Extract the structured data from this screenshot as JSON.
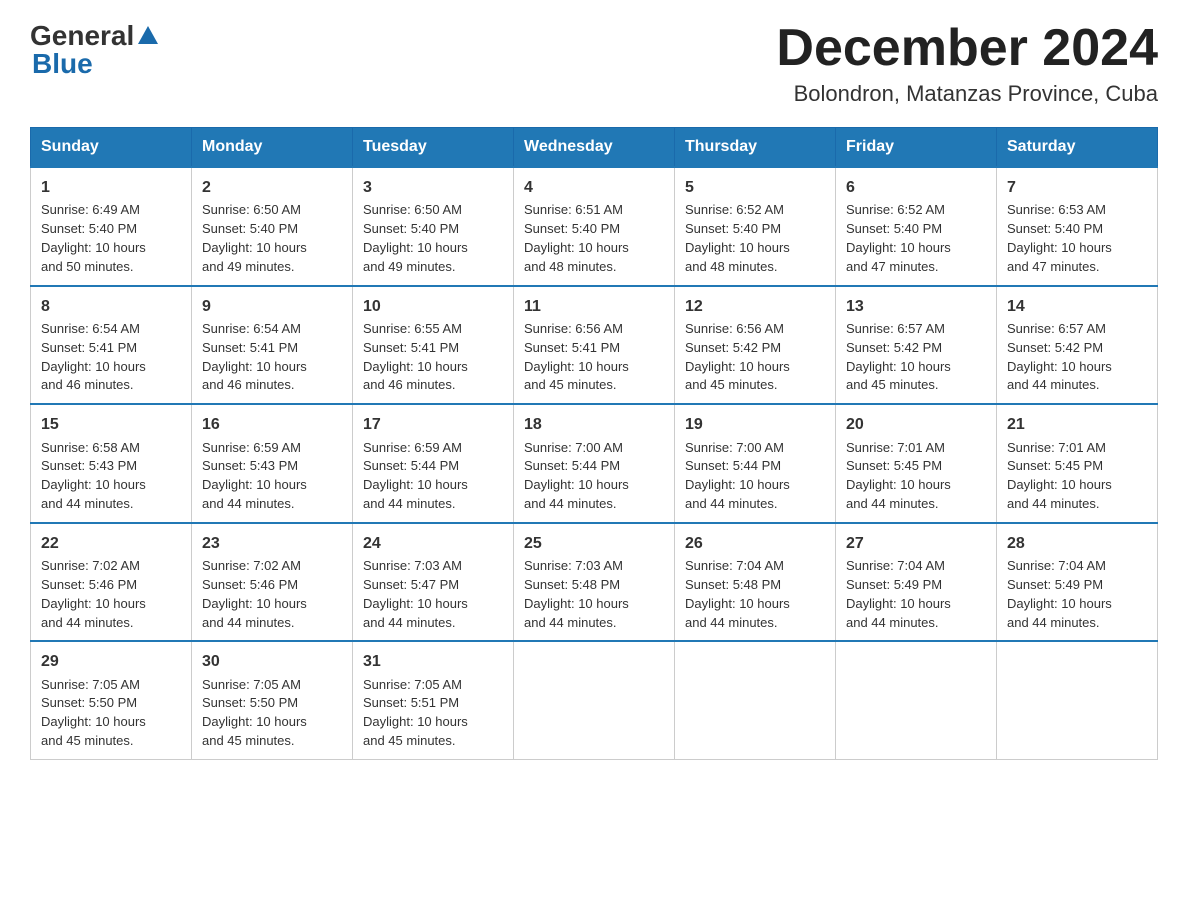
{
  "header": {
    "logo_general": "General",
    "logo_blue": "Blue",
    "month_year": "December 2024",
    "location": "Bolondron, Matanzas Province, Cuba"
  },
  "days_of_week": [
    "Sunday",
    "Monday",
    "Tuesday",
    "Wednesday",
    "Thursday",
    "Friday",
    "Saturday"
  ],
  "weeks": [
    [
      {
        "day": 1,
        "sunrise": "6:49 AM",
        "sunset": "5:40 PM",
        "daylight": "10 hours and 50 minutes."
      },
      {
        "day": 2,
        "sunrise": "6:50 AM",
        "sunset": "5:40 PM",
        "daylight": "10 hours and 49 minutes."
      },
      {
        "day": 3,
        "sunrise": "6:50 AM",
        "sunset": "5:40 PM",
        "daylight": "10 hours and 49 minutes."
      },
      {
        "day": 4,
        "sunrise": "6:51 AM",
        "sunset": "5:40 PM",
        "daylight": "10 hours and 48 minutes."
      },
      {
        "day": 5,
        "sunrise": "6:52 AM",
        "sunset": "5:40 PM",
        "daylight": "10 hours and 48 minutes."
      },
      {
        "day": 6,
        "sunrise": "6:52 AM",
        "sunset": "5:40 PM",
        "daylight": "10 hours and 47 minutes."
      },
      {
        "day": 7,
        "sunrise": "6:53 AM",
        "sunset": "5:40 PM",
        "daylight": "10 hours and 47 minutes."
      }
    ],
    [
      {
        "day": 8,
        "sunrise": "6:54 AM",
        "sunset": "5:41 PM",
        "daylight": "10 hours and 46 minutes."
      },
      {
        "day": 9,
        "sunrise": "6:54 AM",
        "sunset": "5:41 PM",
        "daylight": "10 hours and 46 minutes."
      },
      {
        "day": 10,
        "sunrise": "6:55 AM",
        "sunset": "5:41 PM",
        "daylight": "10 hours and 46 minutes."
      },
      {
        "day": 11,
        "sunrise": "6:56 AM",
        "sunset": "5:41 PM",
        "daylight": "10 hours and 45 minutes."
      },
      {
        "day": 12,
        "sunrise": "6:56 AM",
        "sunset": "5:42 PM",
        "daylight": "10 hours and 45 minutes."
      },
      {
        "day": 13,
        "sunrise": "6:57 AM",
        "sunset": "5:42 PM",
        "daylight": "10 hours and 45 minutes."
      },
      {
        "day": 14,
        "sunrise": "6:57 AM",
        "sunset": "5:42 PM",
        "daylight": "10 hours and 44 minutes."
      }
    ],
    [
      {
        "day": 15,
        "sunrise": "6:58 AM",
        "sunset": "5:43 PM",
        "daylight": "10 hours and 44 minutes."
      },
      {
        "day": 16,
        "sunrise": "6:59 AM",
        "sunset": "5:43 PM",
        "daylight": "10 hours and 44 minutes."
      },
      {
        "day": 17,
        "sunrise": "6:59 AM",
        "sunset": "5:44 PM",
        "daylight": "10 hours and 44 minutes."
      },
      {
        "day": 18,
        "sunrise": "7:00 AM",
        "sunset": "5:44 PM",
        "daylight": "10 hours and 44 minutes."
      },
      {
        "day": 19,
        "sunrise": "7:00 AM",
        "sunset": "5:44 PM",
        "daylight": "10 hours and 44 minutes."
      },
      {
        "day": 20,
        "sunrise": "7:01 AM",
        "sunset": "5:45 PM",
        "daylight": "10 hours and 44 minutes."
      },
      {
        "day": 21,
        "sunrise": "7:01 AM",
        "sunset": "5:45 PM",
        "daylight": "10 hours and 44 minutes."
      }
    ],
    [
      {
        "day": 22,
        "sunrise": "7:02 AM",
        "sunset": "5:46 PM",
        "daylight": "10 hours and 44 minutes."
      },
      {
        "day": 23,
        "sunrise": "7:02 AM",
        "sunset": "5:46 PM",
        "daylight": "10 hours and 44 minutes."
      },
      {
        "day": 24,
        "sunrise": "7:03 AM",
        "sunset": "5:47 PM",
        "daylight": "10 hours and 44 minutes."
      },
      {
        "day": 25,
        "sunrise": "7:03 AM",
        "sunset": "5:48 PM",
        "daylight": "10 hours and 44 minutes."
      },
      {
        "day": 26,
        "sunrise": "7:04 AM",
        "sunset": "5:48 PM",
        "daylight": "10 hours and 44 minutes."
      },
      {
        "day": 27,
        "sunrise": "7:04 AM",
        "sunset": "5:49 PM",
        "daylight": "10 hours and 44 minutes."
      },
      {
        "day": 28,
        "sunrise": "7:04 AM",
        "sunset": "5:49 PM",
        "daylight": "10 hours and 44 minutes."
      }
    ],
    [
      {
        "day": 29,
        "sunrise": "7:05 AM",
        "sunset": "5:50 PM",
        "daylight": "10 hours and 45 minutes."
      },
      {
        "day": 30,
        "sunrise": "7:05 AM",
        "sunset": "5:50 PM",
        "daylight": "10 hours and 45 minutes."
      },
      {
        "day": 31,
        "sunrise": "7:05 AM",
        "sunset": "5:51 PM",
        "daylight": "10 hours and 45 minutes."
      },
      null,
      null,
      null,
      null
    ]
  ]
}
